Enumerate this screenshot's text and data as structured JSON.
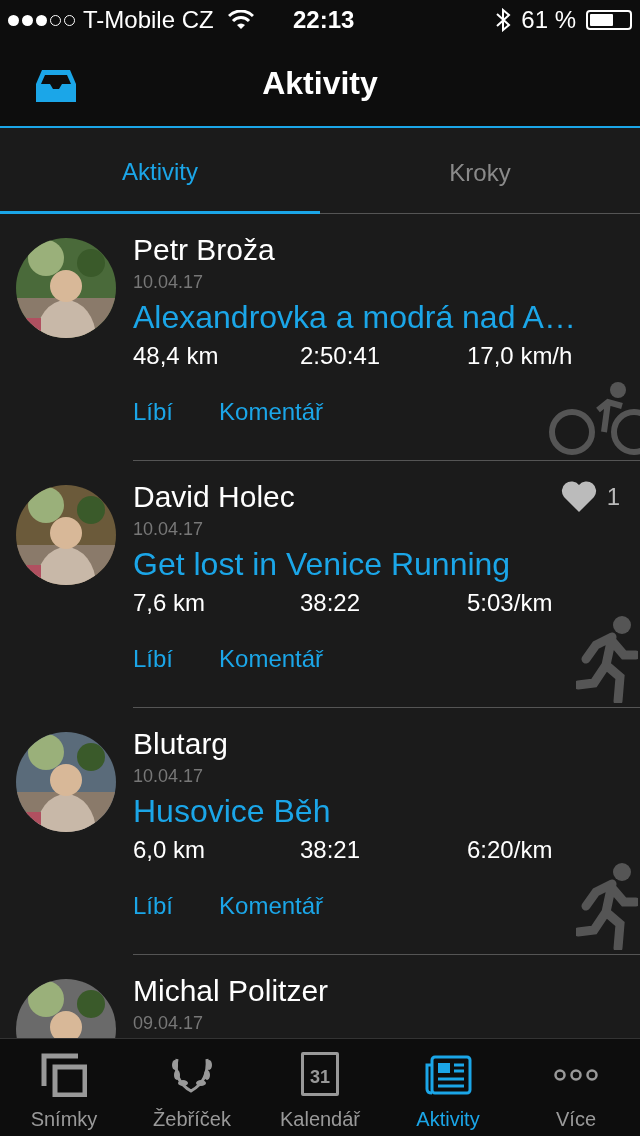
{
  "status_bar": {
    "carrier": "T-Mobile CZ",
    "time": "22:13",
    "battery": "61 %"
  },
  "header": {
    "title": "Aktivity"
  },
  "tabs": [
    {
      "label": "Aktivity",
      "selected": true
    },
    {
      "label": "Kroky",
      "selected": false
    }
  ],
  "feed": [
    {
      "name": "Petr Broža",
      "date": "10.04.17",
      "title": "Alexandrovka a modrá nad A…",
      "stats": [
        "48,4 km",
        "2:50:41",
        "17,0 km/h"
      ],
      "actions": [
        "Líbí",
        "Komentář"
      ],
      "kind": "cycling"
    },
    {
      "name": "David Holec",
      "date": "10.04.17",
      "likes": "1",
      "title": "Get lost in Venice Running",
      "stats": [
        "7,6 km",
        "38:22",
        "5:03/km"
      ],
      "actions": [
        "Líbí",
        "Komentář"
      ],
      "kind": "running"
    },
    {
      "name": "Blutarg",
      "date": "10.04.17",
      "title": "Husovice Běh",
      "stats": [
        "6,0 km",
        "38:21",
        "6:20/km"
      ],
      "actions": [
        "Líbí",
        "Komentář"
      ],
      "kind": "running"
    },
    {
      "name": "Michal Politzer",
      "date": "09.04.17"
    }
  ],
  "bottom_nav": [
    {
      "label": "Snímky",
      "kind": "photos",
      "selected": false
    },
    {
      "label": "Žebříček",
      "kind": "laurel",
      "selected": false
    },
    {
      "label": "Kalendář",
      "kind": "calendar",
      "icon_text": "31",
      "selected": false
    },
    {
      "label": "Aktivity",
      "kind": "news",
      "selected": true
    },
    {
      "label": "Více",
      "kind": "more",
      "selected": false
    }
  ]
}
